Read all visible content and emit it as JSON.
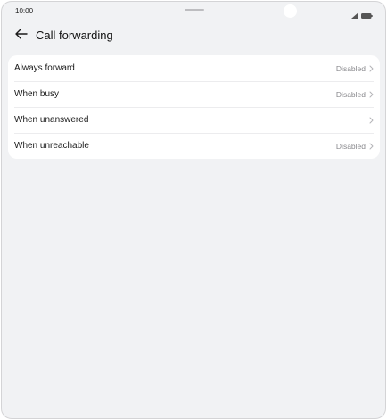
{
  "status_bar": {
    "time": "10:00",
    "icons": [
      "signal-icon",
      "battery-icon"
    ]
  },
  "header": {
    "back_icon": "back-arrow-icon",
    "title": "Call forwarding"
  },
  "settings": {
    "items": [
      {
        "label": "Always forward",
        "value": "Disabled"
      },
      {
        "label": "When busy",
        "value": "Disabled"
      },
      {
        "label": "When unanswered",
        "value": ""
      },
      {
        "label": "When unreachable",
        "value": "Disabled"
      }
    ]
  },
  "colors": {
    "background": "#f1f2f4",
    "card": "#ffffff",
    "text_primary": "#1a1a1a",
    "text_secondary": "#8a8a8e"
  }
}
